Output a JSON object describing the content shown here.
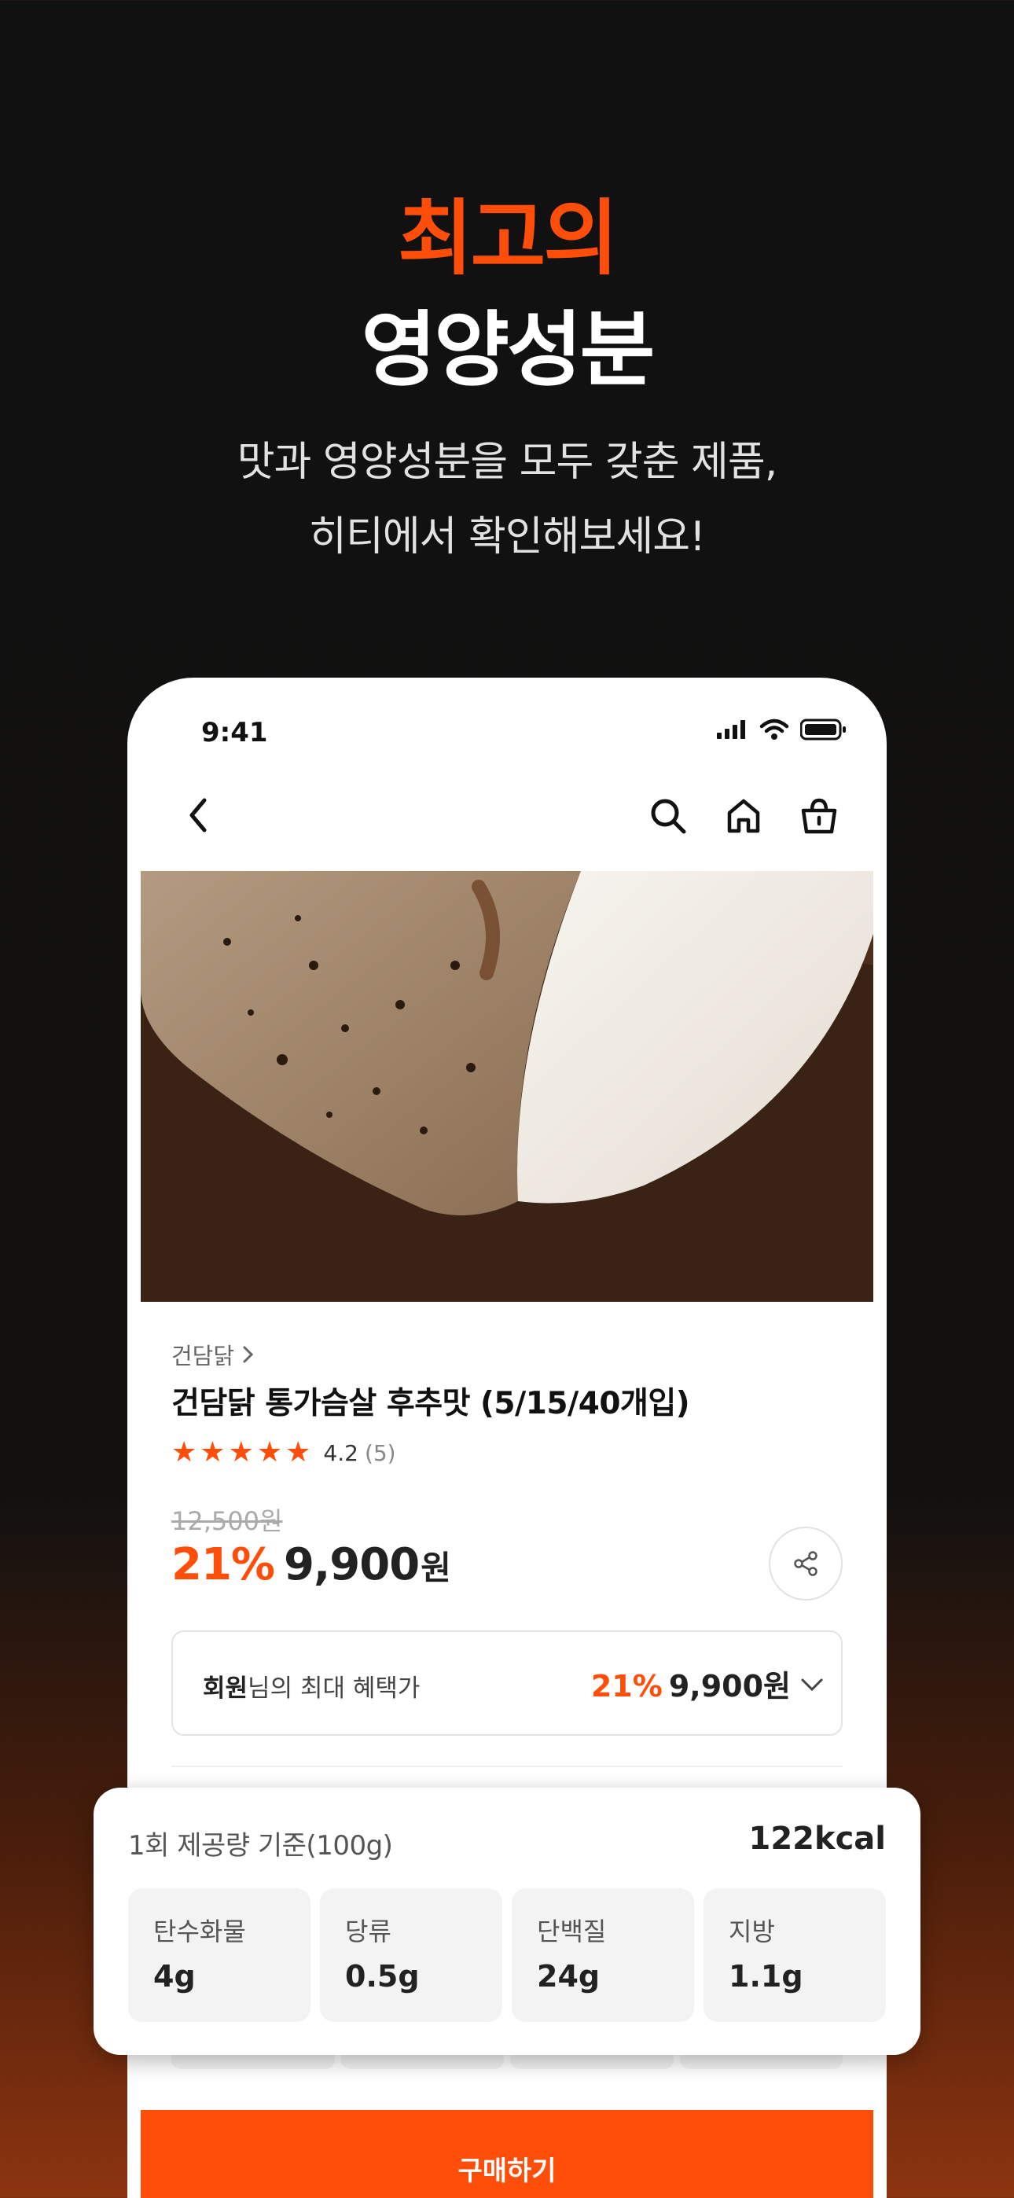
{
  "headline": {
    "accent": "최고의",
    "main": "영양성분"
  },
  "subtitle": {
    "line1": "맛과 영양성분을 모두 갖춘 제품,",
    "line2": "히티에서 확인해보세요!"
  },
  "status_bar": {
    "time": "9:41"
  },
  "gallery": {
    "progress": 0.5
  },
  "product": {
    "brand": "건담닭",
    "name": "건담닭 통가슴살 후추맛 (5/15/40개입)",
    "rating": "4.2",
    "review_count": "(5)",
    "original_price": "12,500원",
    "discount": "21%",
    "price": "9,900",
    "currency": "원"
  },
  "benefit": {
    "label_bold": "회원",
    "label_rest": "님의 최대 혜택가",
    "discount": "21%",
    "price": "9,900원"
  },
  "nutrition": {
    "serving": "1회 제공량 기준(100g)",
    "kcal": "122kcal",
    "items": [
      {
        "label": "탄수화물",
        "value": "4g"
      },
      {
        "label": "당류",
        "value": "0.5g"
      },
      {
        "label": "단백질",
        "value": "24g"
      },
      {
        "label": "지방",
        "value": "1.1g"
      }
    ]
  },
  "buy_button": "구매하기",
  "colors": {
    "accent": "#ff4d0a",
    "background": "#111111"
  },
  "icons": [
    "back-icon",
    "search-icon",
    "home-icon",
    "cart-icon",
    "share-icon",
    "chevron-down-icon",
    "chevron-right-icon",
    "star-icon",
    "signal-icon",
    "wifi-icon",
    "battery-icon"
  ]
}
